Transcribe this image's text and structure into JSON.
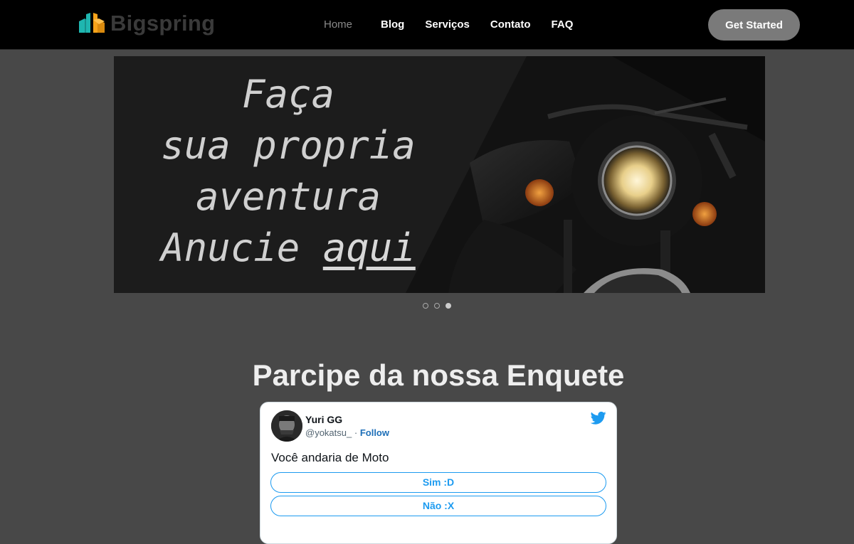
{
  "brand": {
    "name": "Bigspring"
  },
  "nav": {
    "items": [
      {
        "label": "Home",
        "active": true
      },
      {
        "label": "Blog"
      },
      {
        "label": "Serviços"
      },
      {
        "label": "Contato"
      },
      {
        "label": "FAQ"
      }
    ],
    "cta": "Get Started"
  },
  "hero": {
    "lines": [
      "Faça",
      "sua propria",
      "aventura",
      "Anucie"
    ],
    "link_text": "aqui",
    "slide_count": 3,
    "active_slide": 3
  },
  "poll": {
    "title": "Parcipe da nossa Enquete",
    "tweet": {
      "author": "Yuri GG",
      "handle": "@yokatsu_",
      "separator": "·",
      "follow": "Follow",
      "text": "Você andaria de Moto",
      "options": [
        "Sim :D",
        "Não :X"
      ]
    }
  },
  "colors": {
    "background": "#484848",
    "navbar": "#000000",
    "cta_bg": "#7a7a7a",
    "twitter_blue": "#1d9bf0",
    "logo_teal": "#1fb6b0",
    "logo_orange": "#f5a31a"
  },
  "icons": [
    "logo-icon",
    "twitter-bird-icon",
    "motorcycle-image"
  ]
}
